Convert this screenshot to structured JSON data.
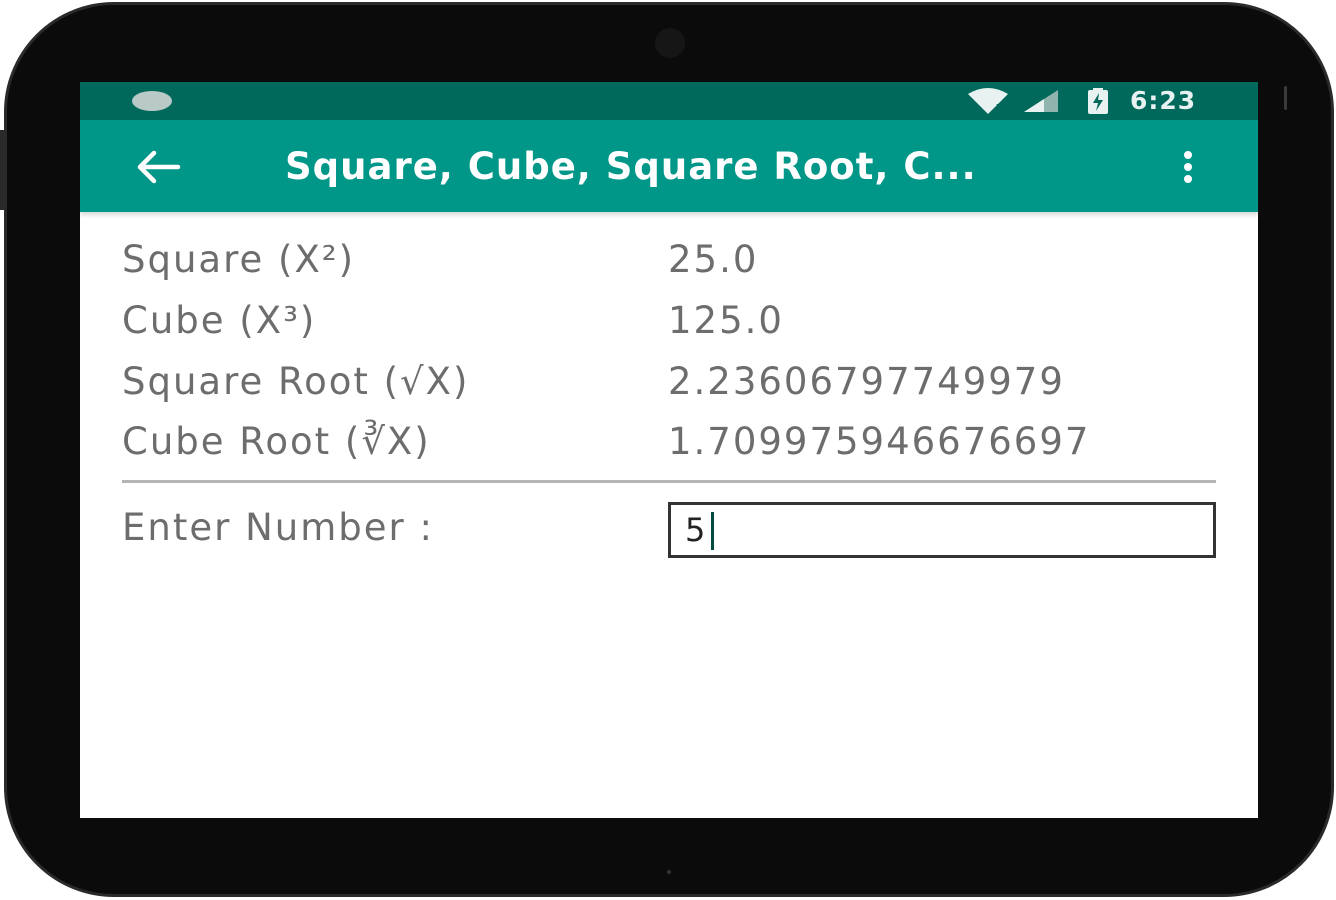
{
  "status_bar": {
    "time": "6:23",
    "icons": [
      "notification-icon",
      "wifi-icon",
      "signal-icon",
      "battery-charging-icon"
    ]
  },
  "app_bar": {
    "title": "Square, Cube, Square Root, C...",
    "back_icon": "arrow-back-icon",
    "menu_icon": "more-vert-icon"
  },
  "results": [
    {
      "label": "Square (X²)",
      "value": "25.0"
    },
    {
      "label": "Cube (X³)",
      "value": "125.0"
    },
    {
      "label": "Square Root (√X)",
      "value": "2.23606797749979"
    },
    {
      "label": "Cube Root (∛X)",
      "value": "1.709975946676697"
    }
  ],
  "input": {
    "label": "Enter Number :",
    "value": "5"
  },
  "colors": {
    "status_bar": "#00695c",
    "app_bar": "#009688",
    "text": "#6d6d6d"
  }
}
